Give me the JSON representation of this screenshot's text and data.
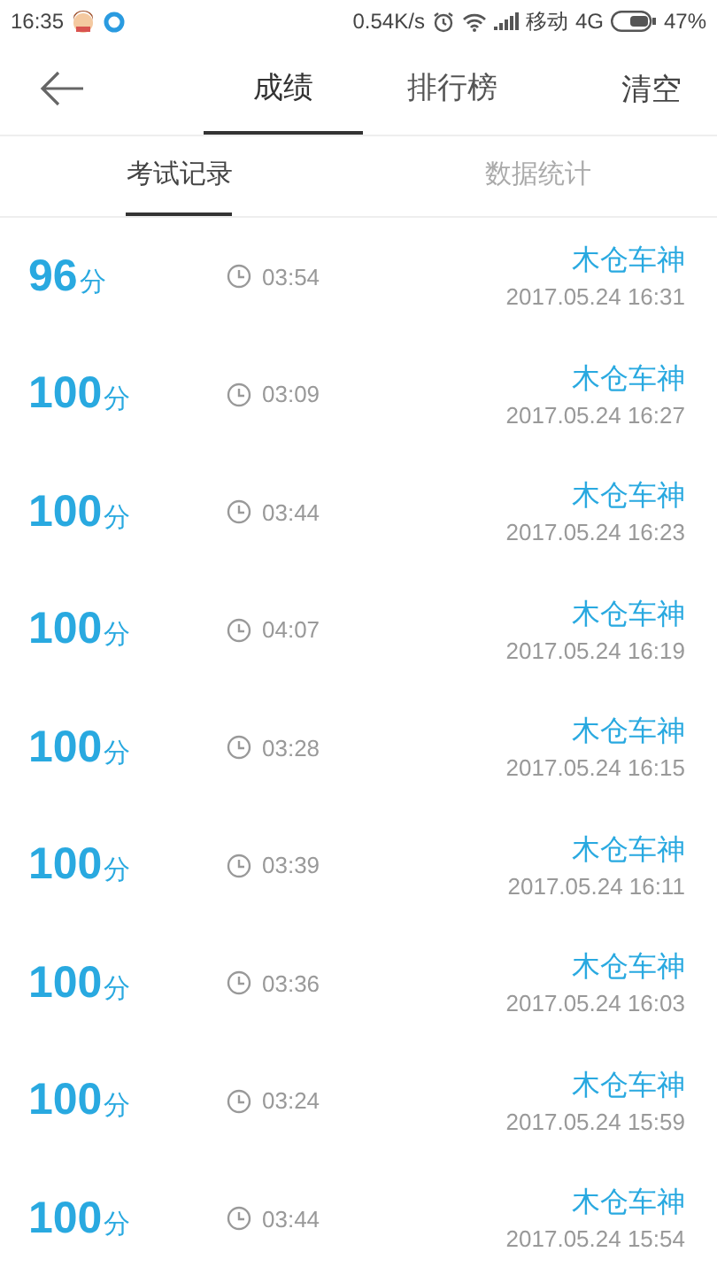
{
  "status_bar": {
    "time": "16:35",
    "speed": "0.54K/s",
    "carrier": "移动",
    "network": "4G",
    "battery": "47%"
  },
  "header": {
    "tabs": [
      {
        "label": "成绩",
        "selected": true
      },
      {
        "label": "排行榜",
        "selected": false
      }
    ],
    "action": "清空"
  },
  "sub_tabs": [
    {
      "label": "考试记录",
      "selected": true
    },
    {
      "label": "数据统计",
      "selected": false
    }
  ],
  "records": [
    {
      "score": "96",
      "unit": "分",
      "duration": "03:54",
      "name": "木仓车神",
      "date": "2017.05.24 16:31"
    },
    {
      "score": "100",
      "unit": "分",
      "duration": "03:09",
      "name": "木仓车神",
      "date": "2017.05.24 16:27"
    },
    {
      "score": "100",
      "unit": "分",
      "duration": "03:44",
      "name": "木仓车神",
      "date": "2017.05.24 16:23"
    },
    {
      "score": "100",
      "unit": "分",
      "duration": "04:07",
      "name": "木仓车神",
      "date": "2017.05.24 16:19"
    },
    {
      "score": "100",
      "unit": "分",
      "duration": "03:28",
      "name": "木仓车神",
      "date": "2017.05.24 16:15"
    },
    {
      "score": "100",
      "unit": "分",
      "duration": "03:39",
      "name": "木仓车神",
      "date": "2017.05.24 16:11"
    },
    {
      "score": "100",
      "unit": "分",
      "duration": "03:36",
      "name": "木仓车神",
      "date": "2017.05.24 16:03"
    },
    {
      "score": "100",
      "unit": "分",
      "duration": "03:24",
      "name": "木仓车神",
      "date": "2017.05.24 15:59"
    },
    {
      "score": "100",
      "unit": "分",
      "duration": "03:44",
      "name": "木仓车神",
      "date": "2017.05.24 15:54"
    }
  ]
}
